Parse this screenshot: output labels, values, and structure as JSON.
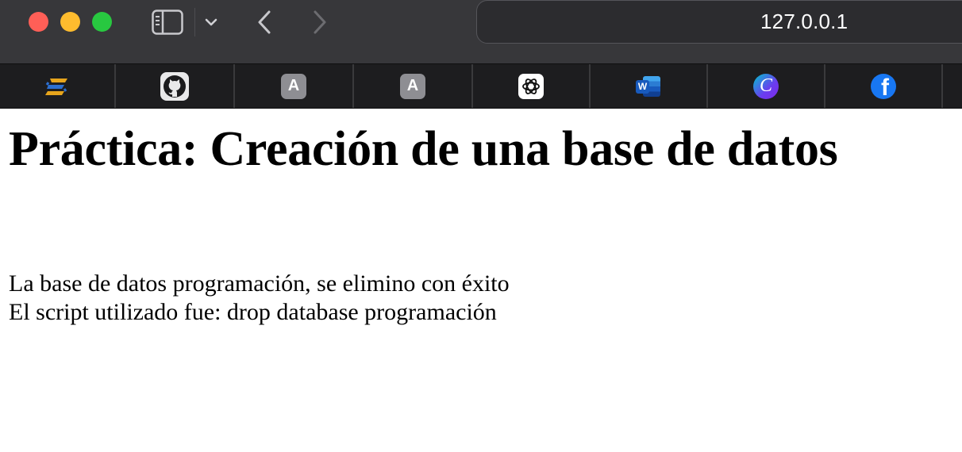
{
  "browser": {
    "url": "127.0.0.1",
    "window_controls": [
      "close",
      "minimize",
      "maximize"
    ],
    "toolbar_icons": [
      "sidebar-icon",
      "chevron-down-icon",
      "back-arrow-icon",
      "forward-arrow-icon"
    ],
    "favorites": [
      {
        "name": "brand-s-icon"
      },
      {
        "name": "github-icon"
      },
      {
        "name": "letter-a-icon",
        "letter": "A"
      },
      {
        "name": "letter-a-icon",
        "letter": "A"
      },
      {
        "name": "openai-icon"
      },
      {
        "name": "word-icon",
        "letter": "W"
      },
      {
        "name": "canva-icon",
        "letter": "C"
      },
      {
        "name": "facebook-icon",
        "letter": "f"
      }
    ]
  },
  "page": {
    "title": "Práctica: Creación de una base de datos",
    "message_line1": "La base de datos programación, se elimino con éxito",
    "message_line2": "El script utilizado fue: drop database programación"
  },
  "colors": {
    "close": "#ff5f57",
    "minimize": "#febc2e",
    "maximize": "#28c840",
    "titlebar": "#37373a",
    "favbar": "#1d1d1f"
  }
}
